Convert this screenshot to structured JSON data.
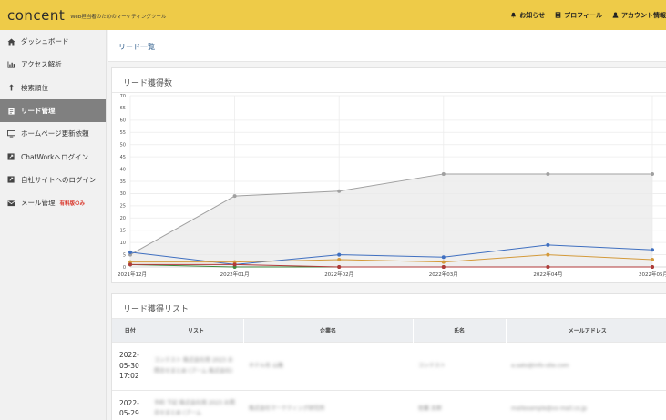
{
  "header": {
    "logo": "concent",
    "tagline": "Web担当者のためのマーケティングツール",
    "nav": [
      {
        "label": "お知らせ",
        "icon": "bell-icon"
      },
      {
        "label": "プロフィール",
        "icon": "profile-card-icon"
      },
      {
        "label": "アカウント情報",
        "icon": "user-icon"
      }
    ]
  },
  "sidebar": {
    "items": [
      {
        "label": "ダッシュボード",
        "icon": "home-icon",
        "active": false
      },
      {
        "label": "アクセス解析",
        "icon": "bar-chart-icon",
        "active": false
      },
      {
        "label": "検索順位",
        "icon": "arrow-up-icon",
        "active": false
      },
      {
        "label": "リード管理",
        "icon": "clipboard-icon",
        "active": true
      },
      {
        "label": "ホームページ更新依頼",
        "icon": "monitor-icon",
        "active": false
      },
      {
        "label": "ChatWorkへログイン",
        "icon": "external-link-icon",
        "active": false
      },
      {
        "label": "自社サイトへのログイン",
        "icon": "external-link-icon",
        "active": false
      },
      {
        "label": "メール管理",
        "icon": "envelope-icon",
        "active": false,
        "badge": "有料版のみ"
      }
    ]
  },
  "page": {
    "title": "リード一覧"
  },
  "chart_panel": {
    "title": "リード獲得数"
  },
  "chart_data": {
    "type": "line",
    "categories": [
      "2021年12月",
      "2022年01月",
      "2022年02月",
      "2022年03月",
      "2022年04月",
      "2022年05月"
    ],
    "ylim": [
      0,
      70
    ],
    "yticks": [
      0,
      5,
      10,
      15,
      20,
      25,
      30,
      35,
      40,
      45,
      50,
      55,
      60,
      65,
      70
    ],
    "grid": true,
    "series": [
      {
        "color": "#a0a0a0",
        "values": [
          5,
          29,
          31,
          38,
          38,
          38
        ],
        "fill": true
      },
      {
        "color": "#3f6fc0",
        "values": [
          6,
          1,
          5,
          4,
          9,
          7
        ]
      },
      {
        "color": "#d49a3a",
        "values": [
          2,
          2,
          3,
          2,
          5,
          3
        ]
      },
      {
        "color": "#3d8a3d",
        "values": [
          1,
          0,
          0,
          0,
          0,
          0
        ]
      },
      {
        "color": "#b23a3a",
        "values": [
          1,
          1,
          0,
          0,
          0,
          0
        ]
      }
    ]
  },
  "list_panel": {
    "title": "リード獲得リスト",
    "columns": [
      "日付",
      "リスト",
      "企業名",
      "氏名",
      "メールアドレス"
    ],
    "rows": [
      {
        "date": [
          "2022-",
          "05-30",
          "17:02"
        ],
        "list": "コンテスト 株式会社用 2023 お問合せまとめ (ブーム 株式会社)",
        "company": "ホテル名 山路",
        "name": "コンテスト",
        "email": "a.sato@info-site.com"
      },
      {
        "date": [
          "2022-",
          "05-29"
        ],
        "list": "予約 下記 株式会社用 2023 お問合せまとめ (ブーム",
        "company": "株式会社マーケティング研究所",
        "name": "佐藤 太郎",
        "email": "mailexample@xx-mail.co.jp"
      }
    ]
  }
}
